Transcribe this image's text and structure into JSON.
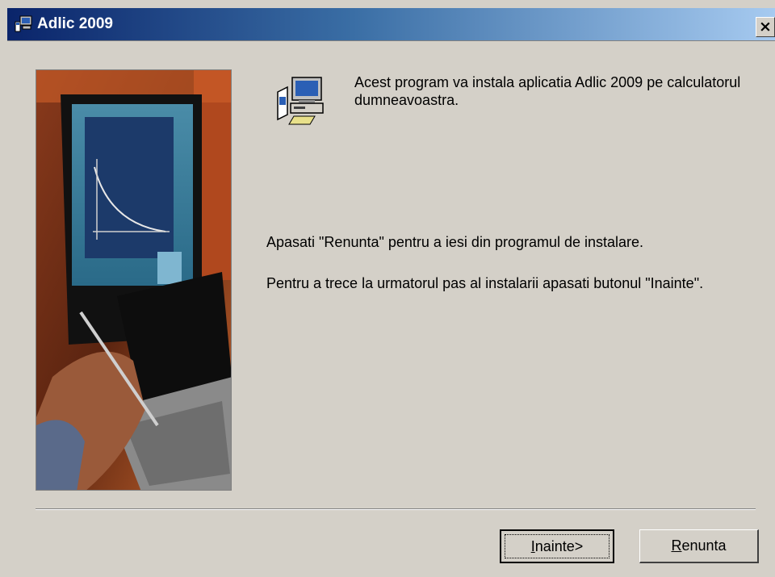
{
  "window": {
    "title": "Adlic 2009",
    "icon": "installer-computer-icon",
    "close_label": "×"
  },
  "content": {
    "intro": "Acest program va instala aplicatia Adlic 2009 pe calculatorul dumneavoastra.",
    "cancel_hint": "Apasati \"Renunta\" pentru a iesi din programul de instalare.",
    "next_hint": "Pentru a trece la urmatorul pas al instalarii apasati butonul \"Inainte\".",
    "setup_icon": "setup-computer-icon",
    "side_image": "tablet-computer-photo"
  },
  "buttons": {
    "next_accel": "I",
    "next_rest": "nainte>",
    "cancel_accel": "R",
    "cancel_rest": "enunta"
  },
  "colors": {
    "titlebar_start": "#0a246a",
    "titlebar_end": "#a6caf0",
    "dialog_bg": "#d4d0c8"
  }
}
